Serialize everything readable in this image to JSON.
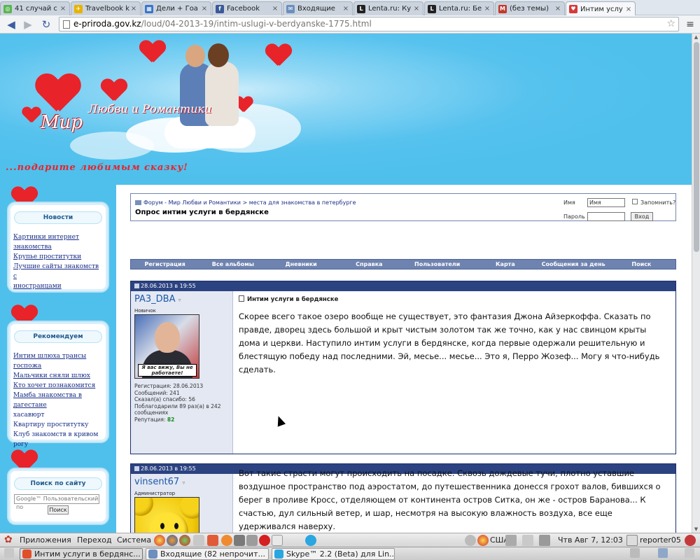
{
  "browser": {
    "tabs": [
      {
        "title": "41 случай с",
        "icon": "counter-icon",
        "color": "#5ab552"
      },
      {
        "title": "Travelbook k",
        "icon": "travelbook-icon",
        "color": "#e8b200"
      },
      {
        "title": "Дели + Гоа",
        "icon": "grid-icon",
        "color": "#3b74c8"
      },
      {
        "title": "Facebook",
        "icon": "facebook-icon",
        "color": "#3b5998"
      },
      {
        "title": "Входящие",
        "icon": "mail-icon",
        "color": "#6d8fbf"
      },
      {
        "title": "Lenta.ru: Ку",
        "icon": "lenta-icon",
        "color": "#222222"
      },
      {
        "title": "Lenta.ru: Бе",
        "icon": "lenta-icon",
        "color": "#222222"
      },
      {
        "title": "(без темы)",
        "icon": "gmail-icon",
        "color": "#c0392b"
      },
      {
        "title": "Интим услу",
        "icon": "heart-site-icon",
        "color": "#d63a3a"
      }
    ],
    "url_host": "e-priroda.gov.kz",
    "url_path": "/loud/04-2013-19/intim-uslugi-v-berdyanske-1775.html"
  },
  "site": {
    "logo_main": "Мир",
    "logo_sub": "Любви и Романтики",
    "slogan": "...подарите любимым сказку!"
  },
  "sidebar": {
    "news": {
      "title": "Новости",
      "items": [
        "Картинки интернет знакомства",
        "Крупье проститутки",
        "Лучшие сайты знакомств с",
        "иностранцами"
      ]
    },
    "recommend": {
      "title": "Рекомендуем",
      "items": [
        "Интим шлюха трансы госпожа",
        "Мальчики сняли шлюх",
        "Кто хочет познакомится",
        "Мамба знакомства в дагестане",
        "хасавюрт",
        "Квартиру проститутку",
        "Клуб знакомств в кривом рогу"
      ]
    },
    "search": {
      "title": "Поиск по сайту",
      "placeholder": "Google™ Пользовательский по",
      "button": "Поиск"
    }
  },
  "forum": {
    "breadcrumb": "Форум - Мир Любви и Романтики > места для знакомства в петербурге",
    "thread_title": "Опрос интим услуги в бердянске",
    "login": {
      "name_label": "Имя",
      "name_value": "Имя",
      "remember_label": "Запомнить?",
      "password_label": "Пароль",
      "login_button": "Вход"
    },
    "nav": [
      "Регистрация",
      "Все альбомы",
      "Дневники",
      "Справка",
      "Пользователи",
      "Карта",
      "Сообщения за день",
      "Поиск"
    ],
    "posts": [
      {
        "date": "28.06.2013 в 19:55",
        "username": "PA3_DBA",
        "role": "Новичок",
        "avatar_caption": "Я вас вижу, Вы не работаете!",
        "stats": [
          "Регистрация: 28.06.2013",
          "Сообщений: 241",
          "Сказал(а) спасибо: 56",
          "Поблагодарили 89 раз(а) в 242",
          "сообщениях"
        ],
        "reputation_label": "Репутация:",
        "reputation": "82",
        "subject": "Интим услуги в бердянске",
        "text": "Скорее всего такое озеро вообще не существует, это фантазия Джона Айзеркоффа. Сказать по правде, дворец здесь большой и крыт чистым золотом так же точно, как у нас свинцом крыты дома и церкви. Наступило интим услуги в бердянске, когда первые одержали решительную и блестящую победу над последними. Эй, месье... месье... Это я, Перро Жозеф... Могу я что-нибудь сделать."
      },
      {
        "date": "28.06.2013 в 19:55",
        "username": "vinsent67",
        "role": "Администратор",
        "text": "Вот такие страсти могут происходить на посадке. Сквозь дождевые тучи, плотно уставшие воздушное пространство под аэростатом, до путешественника донесся грохот валов, бившихся о берег в проливе Кросс, отделяющем от континента остров Ситка, он же - остров Баранова... К счастью, дул сильный ветер, и шар, несмотря на высокую влажность воздуха, все еще удерживался наверху."
      }
    ]
  },
  "desktop": {
    "menu_apps": "Приложения",
    "menu_places": "Переход",
    "menu_system": "Система",
    "keyboard_layout": "США",
    "clock": "Чтв Авг  7, 12:03",
    "user": "reporter05",
    "tasks": [
      {
        "title": "Интим услуги в бердянс...",
        "color": "#e14f2a"
      },
      {
        "title": "Входящие (82 непрочит...",
        "color": "#6d8fbf"
      },
      {
        "title": "Skype™ 2.2 (Beta) для Lin...",
        "color": "#2aa6e0"
      }
    ]
  }
}
